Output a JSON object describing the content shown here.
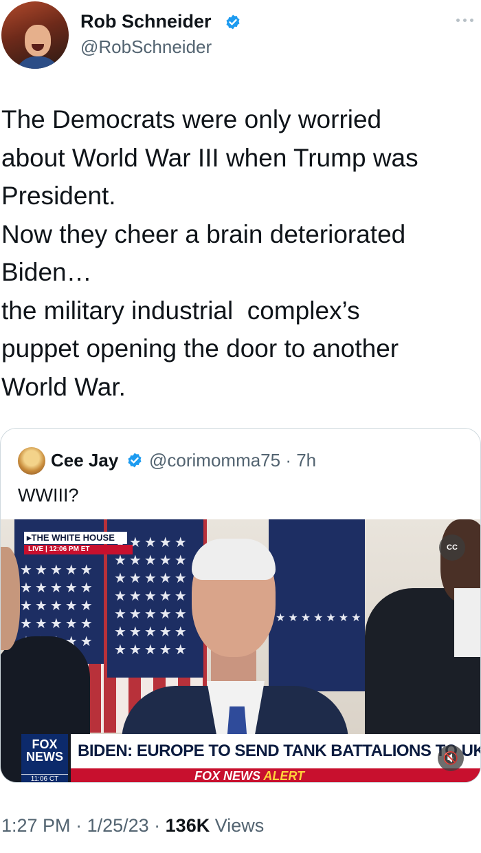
{
  "author": {
    "display_name": "Rob Schneider",
    "handle": "@RobSchneider",
    "verified": true
  },
  "tweet": {
    "text": "The Democrats were only worried\nabout World War III when Trump was\nPresident.\nNow they cheer a brain deteriorated\nBiden…\nthe military industrial  complex’s\npuppet opening the door to another\nWorld War."
  },
  "quoted_tweet": {
    "display_name": "Cee Jay",
    "handle_time": "@corimomma75 · 7h",
    "text": "WWIII?",
    "video": {
      "bug_title": "▸THE WHITE HOUSE",
      "bug_live": "LIVE  |  12:06 PM ET",
      "cc_label": "CC",
      "fox_logo": "FOX\nNEWS",
      "fox_time": "11:06 CT",
      "headline": "BIDEN: EUROPE TO SEND TANK BATTALIONS TO UKRAINE",
      "alert_prefix": "FOX NEWS ",
      "alert_word": "ALERT"
    }
  },
  "meta": {
    "time": "1:27 PM",
    "date": "1/25/23",
    "views_count": "136K",
    "views_label": "Views",
    "sep": " · "
  },
  "colors": {
    "verified_blue": "#1d9bf0",
    "secondary_text": "#536471",
    "fox_red": "#c8102e",
    "fox_blue": "#0c2a6b"
  }
}
